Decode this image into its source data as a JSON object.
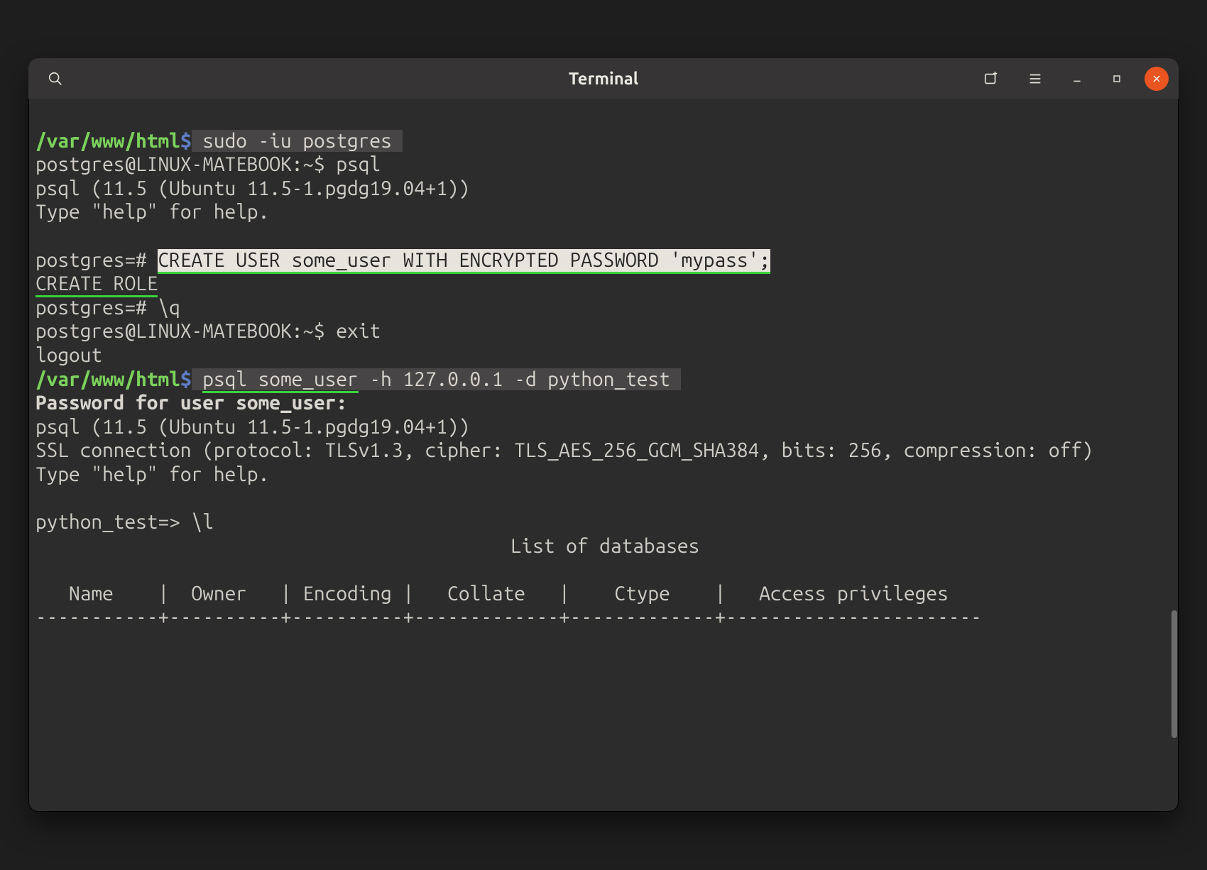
{
  "titlebar": {
    "title": "Terminal"
  },
  "prompt1": {
    "path": "/var/www/html",
    "dollar": "$",
    "cmd": " sudo -iu postgres "
  },
  "line_pg_login": "postgres@LINUX-MATEBOOK:~$ psql",
  "line_psql_ver1": "psql (11.5 (Ubuntu 11.5-1.pgdg19.04+1))",
  "line_help1": "Type \"help\" for help.",
  "sql_prompt1": "postgres=# ",
  "sql_create_user": "CREATE USER some_user WITH ENCRYPTED PASSWORD 'mypass';",
  "sql_response": "CREATE ROLE",
  "sql_quit": "postgres=# \\q",
  "line_exit": "postgres@LINUX-MATEBOOK:~$ exit",
  "line_logout": "logout",
  "prompt2": {
    "path": "/var/www/html",
    "dollar": "$",
    "cmd_pre": " ",
    "cmd_ul": "psql some_user",
    "cmd_post": " -h 127.0.0.1 -d python_test "
  },
  "line_pwprompt": "Password for user some_user:",
  "line_psql_ver2": "psql (11.5 (Ubuntu 11.5-1.pgdg19.04+1))",
  "line_ssl": "SSL connection (protocol: TLSv1.3, cipher: TLS_AES_256_GCM_SHA384, bits: 256, compression: off)",
  "line_help2": "Type \"help\" for help.",
  "sql_list": "python_test=> \\l",
  "db_list_title": "List of databases",
  "db_header": "   Name    |  Owner   | Encoding |   Collate   |    Ctype    |   Access privileges",
  "db_rule": "-----------+----------+----------+-------------+-------------+-----------------------"
}
